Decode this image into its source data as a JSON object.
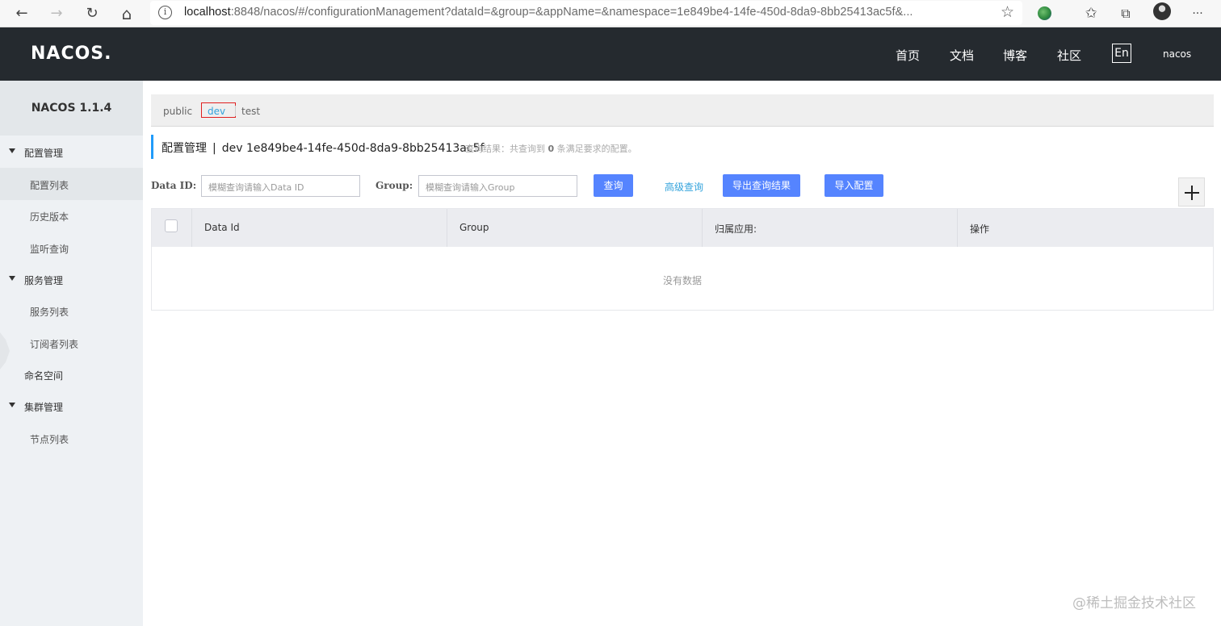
{
  "browser": {
    "url_host": "localhost",
    "url_rest": ":8848/nacos/#/configurationManagement?dataId=&group=&appName=&namespace=1e849be4-14fe-450d-8da9-8bb25413ac5f&...",
    "back_icon": "←",
    "forward_icon": "→",
    "refresh_icon": "↻",
    "home_icon": "⌂",
    "info_icon": "i",
    "favorite_icon": "☆",
    "favorites_icon": "✩",
    "collections_icon": "⧉",
    "more_icon": "···"
  },
  "header": {
    "logo": "NACOS.",
    "nav": [
      "首页",
      "文档",
      "博客",
      "社区"
    ],
    "lang": "En",
    "user": "nacos"
  },
  "sidebar": {
    "title": "NACOS 1.1.4",
    "groups": [
      {
        "label": "配置管理",
        "items": [
          "配置列表",
          "历史版本",
          "监听查询"
        ]
      },
      {
        "label": "服务管理",
        "items": [
          "服务列表",
          "订阅者列表"
        ]
      },
      {
        "label": "命名空间"
      },
      {
        "label": "集群管理",
        "items": [
          "节点列表"
        ]
      }
    ]
  },
  "namespaces": [
    "public",
    "dev",
    "test"
  ],
  "current_namespace": "dev",
  "page": {
    "title": "配置管理",
    "separator": "|",
    "namespace_name": "dev",
    "namespace_id": "1e849be4-14fe-450d-8da9-8bb25413ac5f",
    "query_prefix": "查询结果：共查询到",
    "query_count": "0",
    "query_suffix": "条满足要求的配置。"
  },
  "filters": {
    "data_id_label": "Data ID:",
    "data_id_placeholder": "模糊查询请输入Data ID",
    "group_label": "Group:",
    "group_placeholder": "模糊查询请输入Group",
    "search_button": "查询",
    "advanced_link": "高级查询",
    "export_button": "导出查询结果",
    "import_button": "导入配置",
    "add_icon": "+"
  },
  "table": {
    "columns": [
      "Data Id",
      "Group",
      "归属应用:",
      "操作"
    ],
    "empty_text": "没有数据"
  },
  "watermark": "@稀土掘金技术社区",
  "colors": {
    "header_bg": "#252a2f",
    "primary": "#5584ff",
    "link": "#33a3dc",
    "accent_bar": "#209bfa"
  }
}
